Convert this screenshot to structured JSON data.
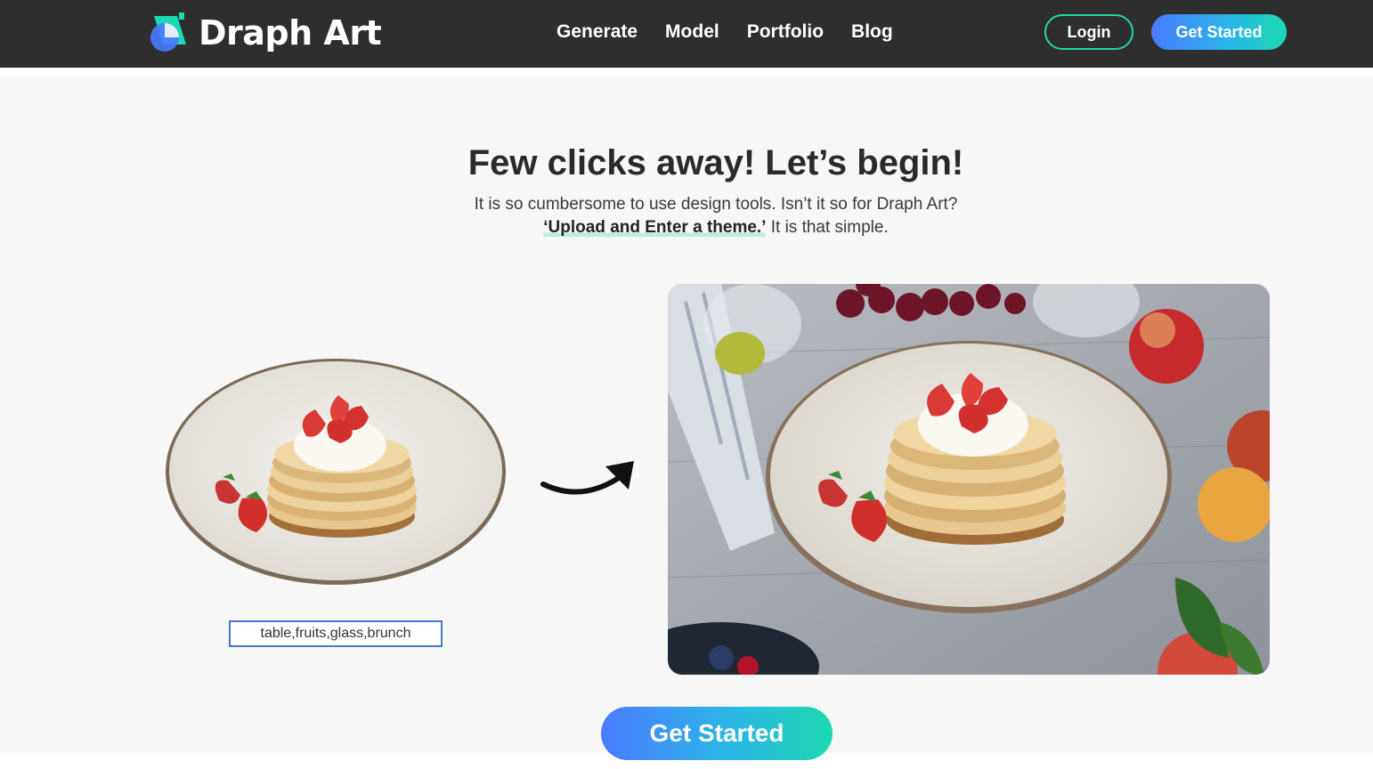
{
  "brand": {
    "name": "Draph Art"
  },
  "nav": {
    "links": [
      "Generate",
      "Model",
      "Portfolio",
      "Blog"
    ],
    "login_label": "Login",
    "get_started_label": "Get Started"
  },
  "hero": {
    "title": "Few clicks away! Let’s begin!",
    "subtitle": "It is so cumbersome to use design tools. Isn’t it so for Draph Art?",
    "highlight": "‘Upload and Enter a theme.’",
    "subtitle_tail": " It is that simple."
  },
  "demo": {
    "theme_input_value": "table,fruits,glass,brunch",
    "input_image_icon": "pancake-plate-image",
    "arrow_icon": "curved-arrow-right-icon",
    "output_image_icon": "styled-pancake-scene-image"
  },
  "cta": {
    "get_started_label": "Get Started"
  },
  "colors": {
    "nav_bg": "#2e2e2e",
    "accent_teal": "#20d6a8",
    "accent_blue": "#4a7bff",
    "page_bg": "#f7f7f7"
  }
}
